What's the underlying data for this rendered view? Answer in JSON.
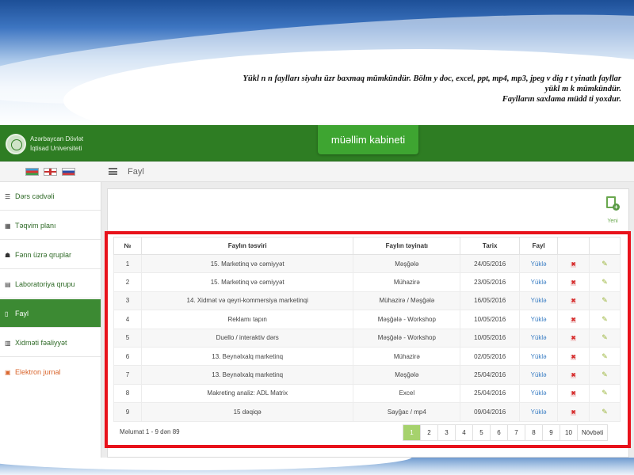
{
  "banner": {
    "notice_line1": "Yükl   n   n faylları siyahı üzr     baxmaq mümkündür. Bölm   y     doc, excel, ppt, mp4, mp3, jpeg v     dig   r  t   yinatlı fayllar",
    "notice_line2": "yükl   m   k mümkündür.",
    "notice_line3": "Faylların saxlama müdd   ti yoxdur."
  },
  "header": {
    "university_line1": "Azərbaycan Dövlət",
    "university_line2": "İqtisad Universiteti",
    "cabinet_label": "müəllim kabineti"
  },
  "languages": [
    "az",
    "en",
    "ru"
  ],
  "breadcrumb": {
    "current": "Fayl"
  },
  "sidebar": {
    "items": [
      {
        "label": "Dərs cədvəli",
        "icon": "list-icon"
      },
      {
        "label": "Təqvim planı",
        "icon": "calendar-icon"
      },
      {
        "label": "Fənn üzrə qruplar",
        "icon": "group-icon"
      },
      {
        "label": "Laboratoriya qrupu",
        "icon": "grid-icon"
      },
      {
        "label": "Fayl",
        "icon": "file-icon"
      },
      {
        "label": "Xidməti fəaliyyət",
        "icon": "chart-icon"
      },
      {
        "label": "Elektron jurnal",
        "icon": "journal-icon"
      }
    ]
  },
  "toolbar": {
    "new_label": "Yeni"
  },
  "table": {
    "headers": [
      "№",
      "Faylın təsviri",
      "Faylın təyinatı",
      "Tarix",
      "Fayl",
      "",
      ""
    ],
    "rows": [
      {
        "n": "1",
        "desc": "15. Marketinq və cəmiyyət",
        "purpose": "Məşğələ",
        "date": "24/05/2016",
        "file": "Yüklə"
      },
      {
        "n": "2",
        "desc": "15. Marketinq və cəmiyyət",
        "purpose": "Mühazirə",
        "date": "23/05/2016",
        "file": "Yüklə"
      },
      {
        "n": "3",
        "desc": "14. Xidmət və qeyri-kommersiya marketinqi",
        "purpose": "Mühazirə / Məşğələ",
        "date": "16/05/2016",
        "file": "Yüklə"
      },
      {
        "n": "4",
        "desc": "Reklamı tapın",
        "purpose": "Məşğələ - Workshop",
        "date": "10/05/2016",
        "file": "Yüklə"
      },
      {
        "n": "5",
        "desc": "Duello / interaktiv dərs",
        "purpose": "Məşğələ - Workshop",
        "date": "10/05/2016",
        "file": "Yüklə"
      },
      {
        "n": "6",
        "desc": "13. Beynəlxalq marketinq",
        "purpose": "Mühazirə",
        "date": "02/05/2016",
        "file": "Yüklə"
      },
      {
        "n": "7",
        "desc": "13. Beynəlxalq marketinq",
        "purpose": "Məşğələ",
        "date": "25/04/2016",
        "file": "Yüklə"
      },
      {
        "n": "8",
        "desc": "Makreting analiz: ADL Matrix",
        "purpose": "Excel",
        "date": "25/04/2016",
        "file": "Yüklə"
      },
      {
        "n": "9",
        "desc": "15 dəqiqə",
        "purpose": "Sayğac / mp4",
        "date": "09/04/2016",
        "file": "Yüklə"
      }
    ]
  },
  "footer": {
    "info": "Məlumat 1 - 9 dən 89",
    "pages": [
      "1",
      "2",
      "3",
      "4",
      "5",
      "6",
      "7",
      "8",
      "9",
      "10"
    ],
    "active_page": "1",
    "next_label": "Növbəti"
  },
  "colors": {
    "header_green": "#2e7d23",
    "active_green": "#3c8a33",
    "highlight_red": "#e8121b",
    "link_blue": "#3c7fc4",
    "pager_active": "#a6d26d"
  }
}
